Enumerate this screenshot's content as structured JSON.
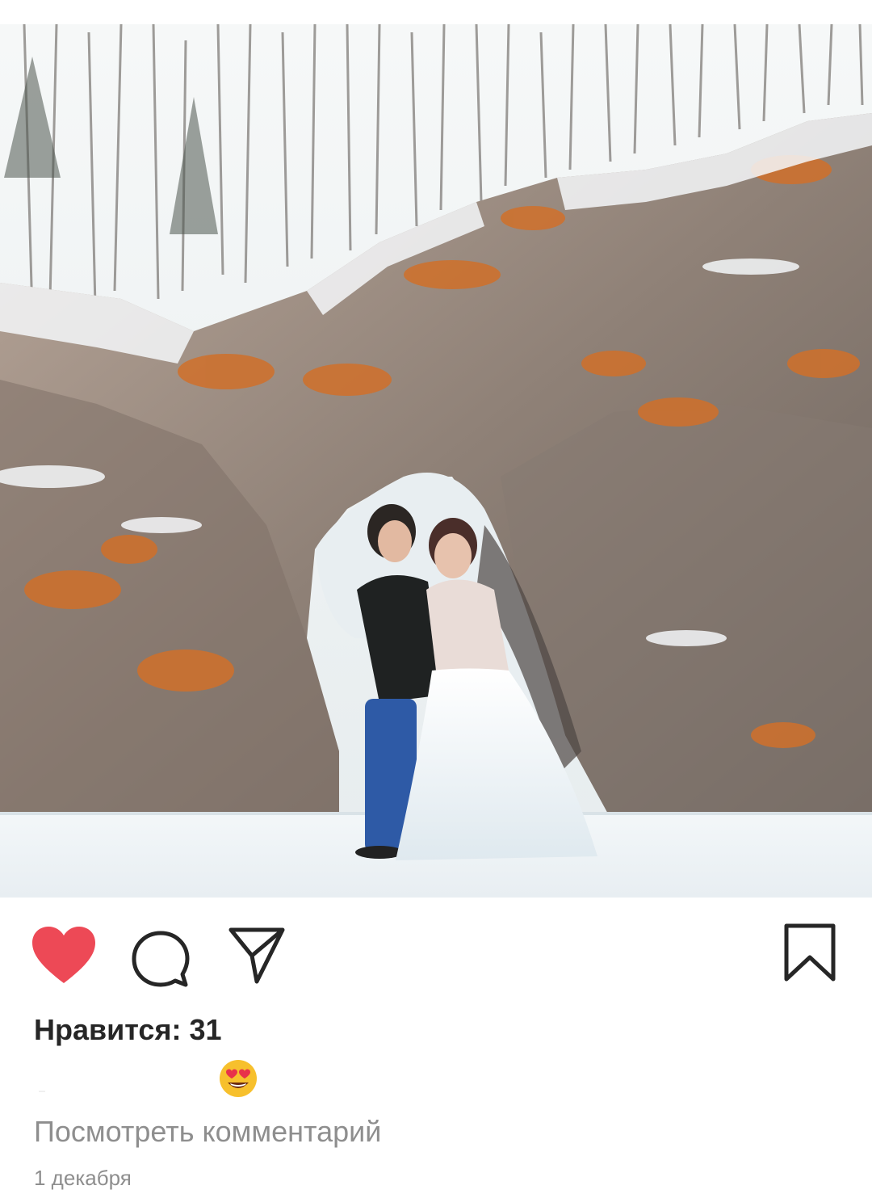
{
  "post": {
    "image_alt": "Wedding couple in front of snowy rock arch",
    "likes_label": "Нравится: 31",
    "caption_emoji": "heart-eyes-emoji",
    "view_comments_label": "Посмотреть комментарий",
    "date": "1 декабря"
  },
  "icons": {
    "like": "heart-icon",
    "comment": "comment-icon",
    "share": "paper-plane-icon",
    "save": "bookmark-icon"
  },
  "colors": {
    "like_active": "#ed4956",
    "text_primary": "#262626",
    "text_secondary": "#8e8e8e"
  }
}
